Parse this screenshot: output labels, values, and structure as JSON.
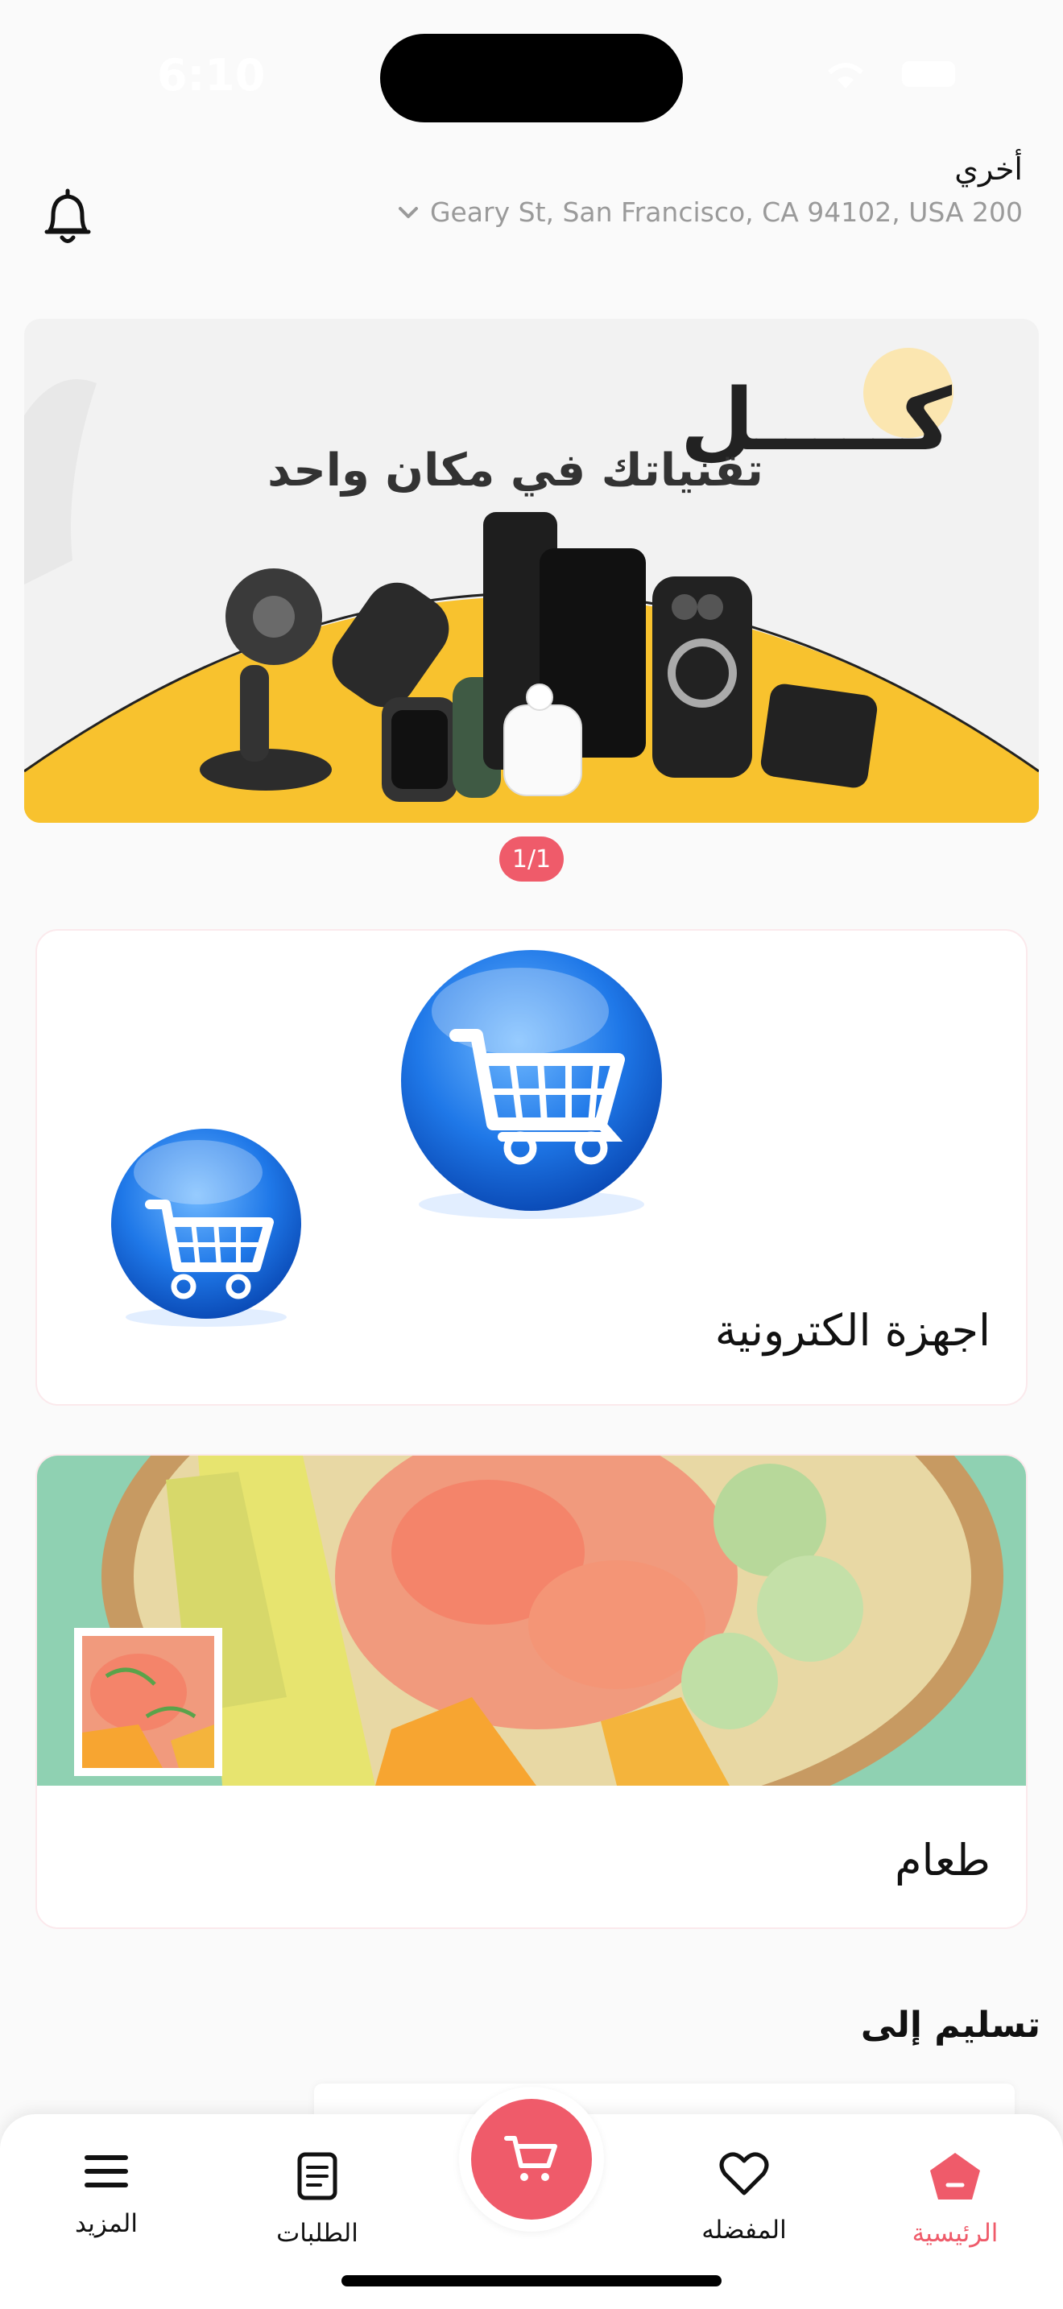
{
  "status_bar": {
    "time": "6:10"
  },
  "header": {
    "address_label": "أخري",
    "address": "Geary St, San Francisco, CA 94102, USA 200"
  },
  "banner": {
    "headline": "كـــــل",
    "subtitle": "تقنياتك في مكان واحد",
    "pager": "1/1",
    "colors": {
      "accent": "#f8c22e",
      "background": "#f2f2f2"
    }
  },
  "categories": [
    {
      "title": "اجهزة الكترونية",
      "icon": "shopping-cart-globe-icon"
    },
    {
      "title": "طعام",
      "icon": "poke-bowl-image"
    }
  ],
  "delivery": {
    "title": "تسليم إلى"
  },
  "tabbar": {
    "more": "المزيد",
    "orders": "الطلبات",
    "favorites": "المفضله",
    "home": "الرئيسية"
  },
  "colors": {
    "primary": "#ef5b6a",
    "text": "#111111",
    "muted": "#9a9a9a"
  }
}
